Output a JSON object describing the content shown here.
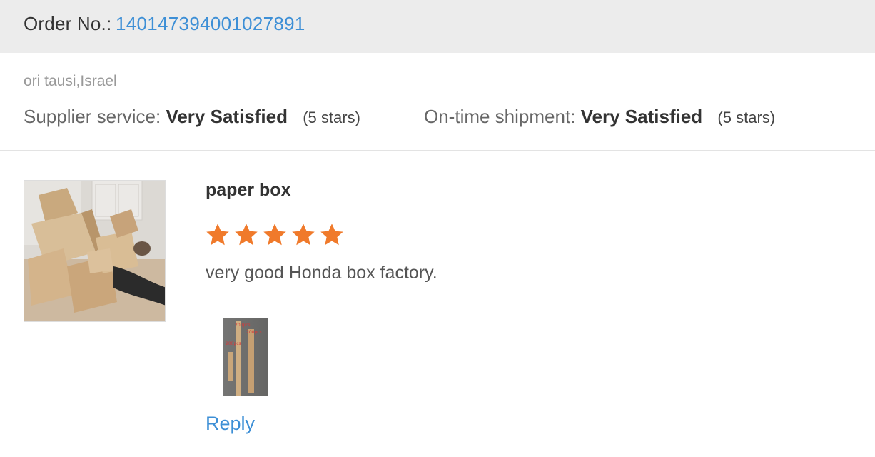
{
  "order": {
    "label": "Order No.:",
    "number": "140147394001027891"
  },
  "buyer": {
    "name_location": "ori tausi,Israel"
  },
  "ratings": [
    {
      "label": "Supplier service:",
      "value": "Very Satisfied",
      "stars_text": "(5 stars)"
    },
    {
      "label": "On-time shipment:",
      "value": "Very Satisfied",
      "stars_text": "(5 stars)"
    }
  ],
  "review": {
    "product_title": "paper box",
    "rating": 5,
    "rating_max": 5,
    "text": "very good Honda box factory.",
    "photo_labels": [
      "200pcs",
      "200pcs",
      "200pcs"
    ],
    "reply_label": "Reply"
  },
  "colors": {
    "accent": "#3d8fd6",
    "star": "#f07a2b",
    "order_bar": "#ececec"
  },
  "icons": [
    "star-icon"
  ]
}
